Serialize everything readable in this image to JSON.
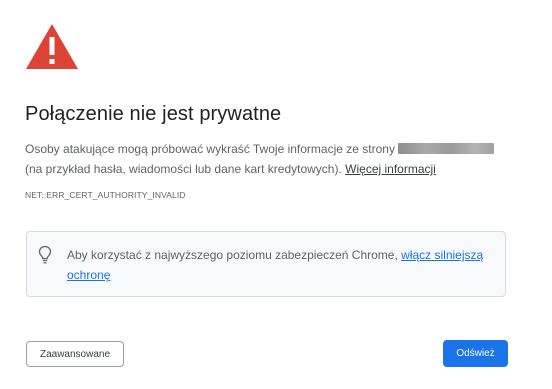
{
  "colors": {
    "warning_red": "#db4437",
    "primary_blue": "#1a73e8",
    "title_text": "#202124",
    "body_text": "#5f6368",
    "box_background": "#f8f9fa",
    "box_border": "#dadce0"
  },
  "icons": {
    "warning": "warning-triangle-icon",
    "tip": "lightbulb-icon"
  },
  "title": "Połączenie nie jest prywatne",
  "description": {
    "text_before": "Osoby atakujące mogą próbować wykraść Twoje informacje ze strony",
    "text_after": "(na przykład hasła, wiadomości lub dane kart kredytowych).",
    "learn_more_link": "Więcej informacji"
  },
  "error_code": "NET::ERR_CERT_AUTHORITY_INVALID",
  "enhanced_protection": {
    "text": "Aby korzystać z najwyższego poziomu zabezpieczeń Chrome,",
    "link": "włącz silniejszą ochronę"
  },
  "buttons": {
    "advanced": "Zaawansowane",
    "reload": "Odśwież"
  }
}
